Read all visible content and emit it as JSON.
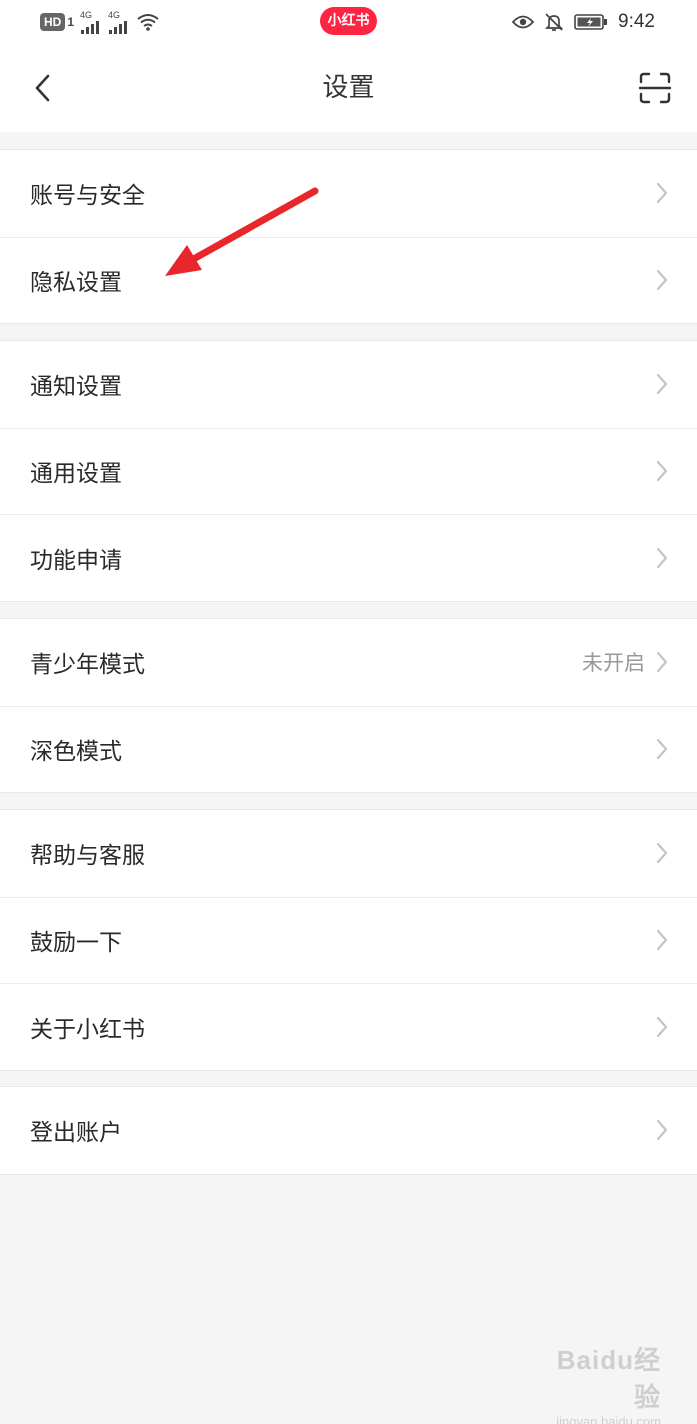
{
  "status_bar": {
    "hd_badge": "HD",
    "sim_number": "1",
    "network_1": "4G",
    "network_2": "4G",
    "brand": "小红书",
    "clock": "9:42"
  },
  "nav": {
    "title": "设置"
  },
  "groups": [
    {
      "items": [
        {
          "label": "账号与安全"
        },
        {
          "label": "隐私设置"
        }
      ]
    },
    {
      "items": [
        {
          "label": "通知设置"
        },
        {
          "label": "通用设置"
        },
        {
          "label": "功能申请"
        }
      ]
    },
    {
      "items": [
        {
          "label": "青少年模式",
          "value": "未开启"
        },
        {
          "label": "深色模式"
        }
      ]
    },
    {
      "items": [
        {
          "label": "帮助与客服"
        },
        {
          "label": "鼓励一下"
        },
        {
          "label": "关于小红书"
        }
      ]
    },
    {
      "items": [
        {
          "label": "登出账户"
        }
      ]
    }
  ],
  "watermark": {
    "logo": "Baidu经验",
    "sub": "jingyan.baidu.com"
  },
  "colors": {
    "brand_red": "#ff2442",
    "annotation_arrow": "#e8262b",
    "background": "#f5f5f5"
  }
}
